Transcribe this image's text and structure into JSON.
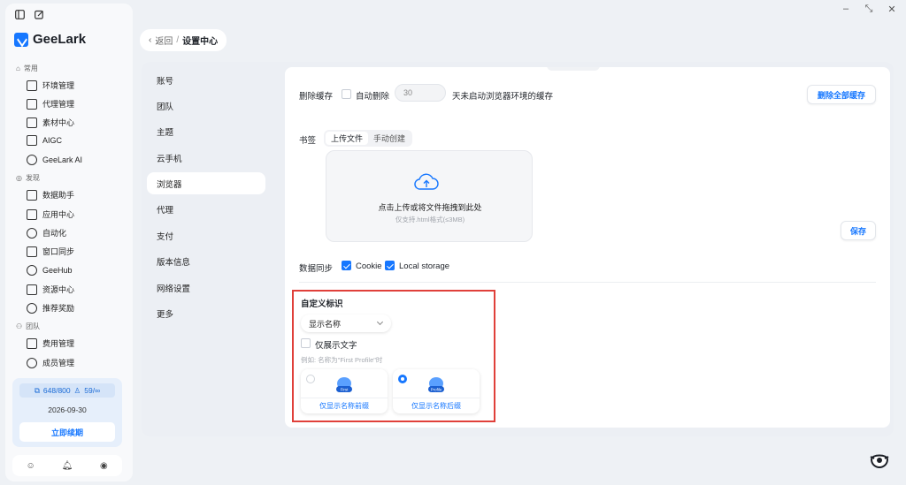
{
  "window": {
    "minimize": "–",
    "restore": "⤡",
    "close": "✕"
  },
  "sidebar": {
    "brand": "GeeLark",
    "sections": [
      {
        "title": "常用",
        "items": [
          "环境管理",
          "代理管理",
          "素材中心",
          "AIGC",
          "GeeLark AI"
        ]
      },
      {
        "title": "发现",
        "items": [
          "数据助手",
          "应用中心",
          "自动化",
          "窗口同步",
          "GeeHub",
          "资源中心",
          "推荐奖励"
        ]
      },
      {
        "title": "团队",
        "items": [
          "费用管理",
          "成员管理"
        ]
      }
    ],
    "quota": {
      "profiles": "648/800",
      "members": "59/∞",
      "date": "2026-09-30",
      "renew": "立即续期"
    }
  },
  "breadcrumb": {
    "back": "返回",
    "sep": "/",
    "current": "设置中心"
  },
  "settings_nav": [
    "账号",
    "团队",
    "主题",
    "云手机",
    "浏览器",
    "代理",
    "支付",
    "版本信息",
    "网络设置",
    "更多"
  ],
  "settings_nav_active": "浏览器",
  "cache": {
    "label": "删除缓存",
    "auto_delete_label": "自动删除",
    "days_value": "30",
    "days_suffix": "天未启动浏览器环境的缓存",
    "delete_all_button": "删除全部缓存"
  },
  "bookmark": {
    "label": "书签",
    "tabs": [
      "上传文件",
      "手动创建"
    ],
    "upload_main": "点击上传或将文件拖拽到此处",
    "upload_sub": "仅支持.html格式(≤3MB)",
    "save_button": "保存"
  },
  "sync": {
    "label": "数据同步",
    "cookie": "Cookie",
    "local_storage": "Local storage",
    "cookie_checked": true,
    "local_storage_checked": true
  },
  "custom_tag": {
    "title": "自定义标识",
    "select_value": "显示名称",
    "text_only_label": "仅展示文字",
    "example": "例如: 名称为\"First Profile\"时",
    "options": [
      {
        "thumb_text": "First",
        "caption": "仅显示名称前缀",
        "selected": false
      },
      {
        "thumb_text": "Profile",
        "caption": "仅显示名称后缀",
        "selected": true
      }
    ]
  },
  "colors": {
    "accent": "#1677ff",
    "highlight_border": "#e0403a"
  }
}
